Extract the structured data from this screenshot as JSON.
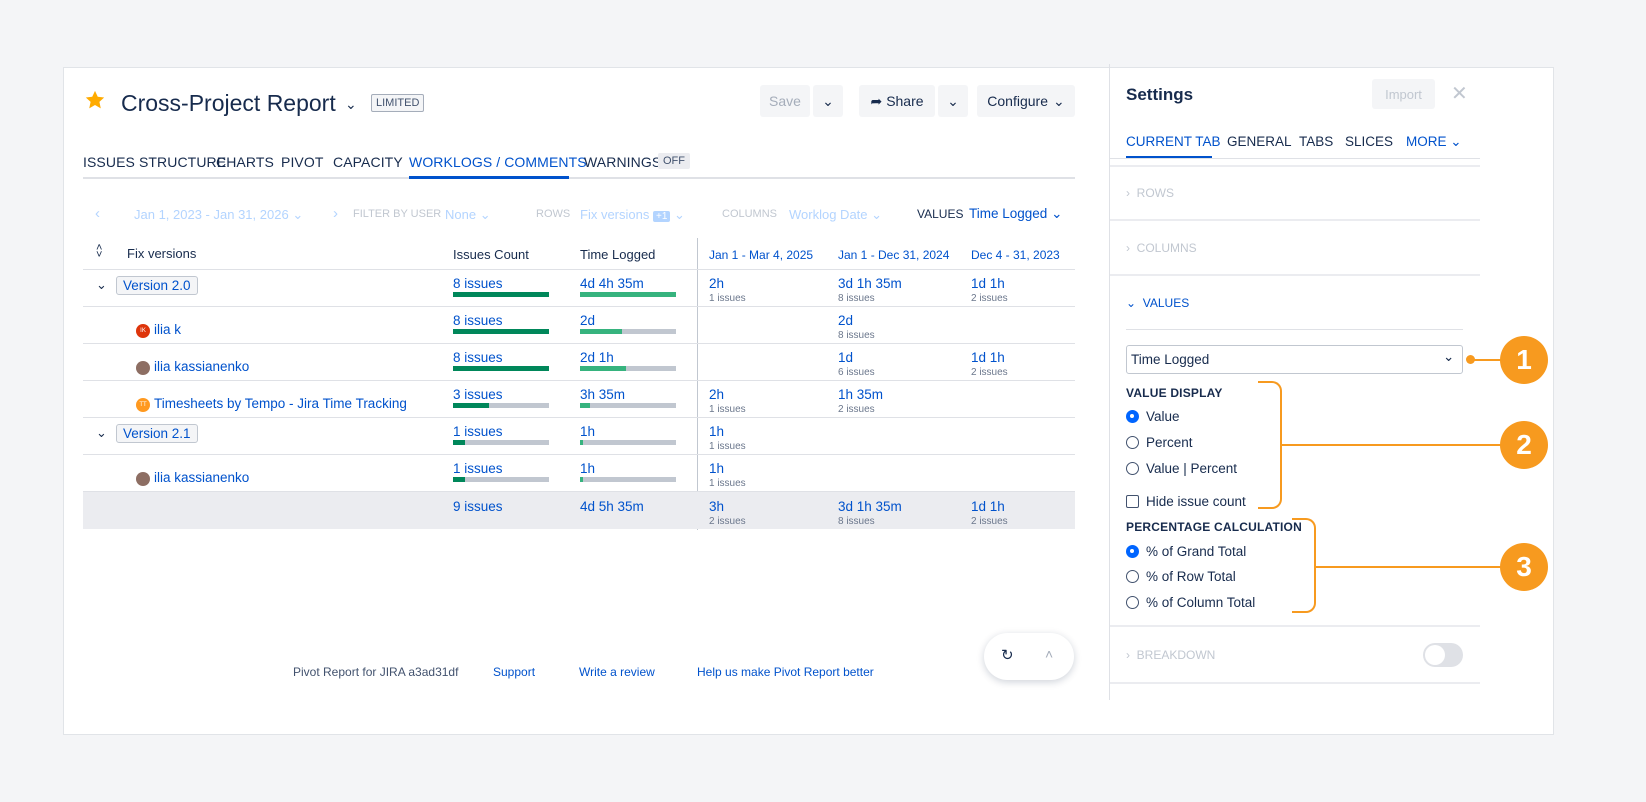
{
  "header": {
    "title": "Cross-Project Report",
    "badge": "LIMITED",
    "save_label": "Save",
    "share_label": "Share",
    "configure_label": "Configure"
  },
  "tabs": [
    {
      "label": "ISSUES STRUCTURE"
    },
    {
      "label": "CHARTS"
    },
    {
      "label": "PIVOT"
    },
    {
      "label": "CAPACITY"
    },
    {
      "label": "WORKLOGS / COMMENTS"
    },
    {
      "label": "WARNINGS"
    }
  ],
  "warnings_badge": "OFF",
  "filter": {
    "date_range": "Jan 1, 2023 - Jan 31, 2026",
    "filter_by_user_label": "FILTER BY USER",
    "filter_by_user_value": "None",
    "rows_label": "ROWS",
    "rows_value": "Fix versions",
    "rows_extra": "+1",
    "columns_label": "COLUMNS",
    "columns_value": "Worklog Date",
    "values_label": "VALUES",
    "values_value": "Time Logged"
  },
  "table": {
    "headers": [
      "Fix versions",
      "Issues Count",
      "Time Logged",
      "Jan 1 - Mar 4, 2025",
      "Jan 1 - Dec 31, 2024",
      "Dec 4 - 31, 2023"
    ],
    "rows": [
      {
        "name": "Version 2.0",
        "issues": "8 issues",
        "time": "4d 4h 35m",
        "c1": "2h",
        "c1s": "1 issues",
        "c2": "3d 1h 35m",
        "c2s": "8 issues",
        "c3": "1d 1h",
        "c3s": "2 issues",
        "issues_fill": 1.0,
        "time_fill": 1.0
      },
      {
        "name": "ilia k",
        "avatar": "IK",
        "issues": "8 issues",
        "time": "2d",
        "c1": "",
        "c1s": "",
        "c2": "2d",
        "c2s": "8 issues",
        "c3": "",
        "c3s": "",
        "issues_fill": 1.0,
        "time_fill": 0.44
      },
      {
        "name": "ilia kassianenko",
        "issues": "8 issues",
        "time": "2d 1h",
        "c1": "",
        "c1s": "",
        "c2": "1d",
        "c2s": "6 issues",
        "c3": "1d 1h",
        "c3s": "2 issues",
        "issues_fill": 1.0,
        "time_fill": 0.48
      },
      {
        "name": "Timesheets by Tempo - Jira Time Tracking",
        "avatar": "TT",
        "issues": "3 issues",
        "time": "3h 35m",
        "c1": "2h",
        "c1s": "1 issues",
        "c2": "1h 35m",
        "c2s": "2 issues",
        "c3": "",
        "c3s": "",
        "issues_fill": 0.38,
        "time_fill": 0.1
      },
      {
        "name": "Version 2.1",
        "issues": "1 issues",
        "time": "1h",
        "c1": "1h",
        "c1s": "1 issues",
        "c2": "",
        "c2s": "",
        "c3": "",
        "c3s": "",
        "issues_fill": 0.13,
        "time_fill": 0.03
      },
      {
        "name": "ilia kassianenko",
        "issues": "1 issues",
        "time": "1h",
        "c1": "1h",
        "c1s": "1 issues",
        "c2": "",
        "c2s": "",
        "c3": "",
        "c3s": "",
        "issues_fill": 0.13,
        "time_fill": 0.03
      }
    ],
    "total": {
      "issues": "9 issues",
      "time": "4d 5h 35m",
      "c1": "3h",
      "c1s": "2 issues",
      "c2": "3d 1h 35m",
      "c2s": "8 issues",
      "c3": "1d 1h",
      "c3s": "2 issues"
    }
  },
  "footer": {
    "version": "Pivot Report for JIRA a3ad31df",
    "support": "Support",
    "review": "Write a review",
    "help": "Help us make Pivot Report better"
  },
  "settings": {
    "title": "Settings",
    "import_label": "Import",
    "tabs": [
      "CURRENT TAB",
      "GENERAL",
      "TABS",
      "SLICES",
      "MORE"
    ],
    "sections": {
      "rows": "ROWS",
      "columns": "COLUMNS",
      "values": "VALUES",
      "breakdown": "BREAKDOWN"
    },
    "values_select": "Time Logged",
    "value_display_label": "VALUE DISPLAY",
    "value_display_options": [
      "Value",
      "Percent",
      "Value | Percent"
    ],
    "value_display_selected": "Value",
    "hide_issue_count": "Hide issue count",
    "percentage_label": "PERCENTAGE CALCULATION",
    "percentage_options": [
      "% of Grand Total",
      "% of Row Total",
      "% of Column Total"
    ],
    "percentage_selected": "% of Grand Total"
  },
  "callouts": [
    "1",
    "2",
    "3"
  ],
  "colors": {
    "accent": "#0052cc",
    "bar_dark": "#00875a",
    "bar_light": "#36b37e",
    "callout": "#f79a1f"
  }
}
